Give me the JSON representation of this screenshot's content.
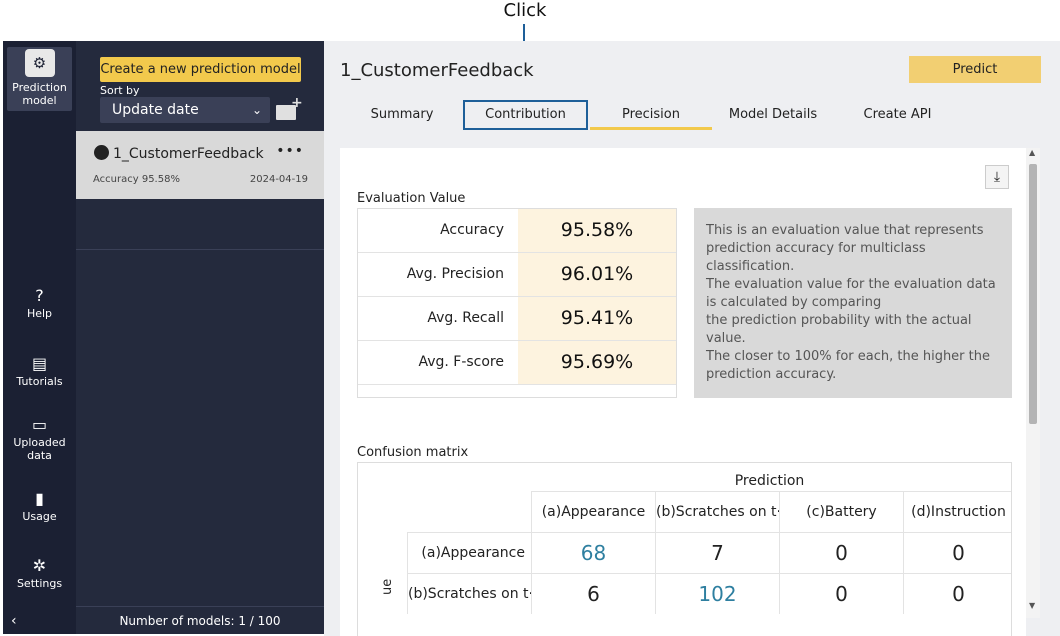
{
  "callout": {
    "label": "Click"
  },
  "rail": {
    "items": [
      {
        "label": "Prediction model"
      },
      {
        "label": "Help"
      },
      {
        "label": "Tutorials"
      },
      {
        "label": "Uploaded data"
      },
      {
        "label": "Usage"
      },
      {
        "label": "Settings"
      }
    ]
  },
  "sidebar": {
    "new_model_button": "Create a new prediction model",
    "sort_label": "Sort by",
    "sort_value": "Update date",
    "models": [
      {
        "name": "1_CustomerFeedback",
        "accuracy": "Accuracy 95.58%",
        "date": "2024-04-19"
      }
    ],
    "footer": "Number of models: 1 / 100"
  },
  "header": {
    "title": "1_CustomerFeedback",
    "predict_button": "Predict"
  },
  "tabs": [
    {
      "label": "Summary"
    },
    {
      "label": "Contribution"
    },
    {
      "label": "Precision"
    },
    {
      "label": "Model Details"
    },
    {
      "label": "Create API"
    }
  ],
  "evaluation": {
    "title": "Evaluation Value",
    "rows": [
      {
        "label": "Accuracy",
        "value": "95.58%"
      },
      {
        "label": "Avg. Precision",
        "value": "96.01%"
      },
      {
        "label": "Avg. Recall",
        "value": "95.41%"
      },
      {
        "label": "Avg. F-score",
        "value": "95.69%"
      }
    ],
    "note": "This is an evaluation value that represents prediction accuracy for multiclass classification.\n The evaluation value for the evaluation data is calculated by comparing\n the prediction probability with the actual value.\n The closer to 100% for each, the higher the prediction accuracy."
  },
  "confusion": {
    "title": "Confusion matrix",
    "prediction_label": "Prediction",
    "true_label_visible": "ue",
    "columns": [
      "(a)Appearance",
      "(b)Scratches on t···",
      "(c)Battery",
      "(d)Instruction"
    ],
    "rows": [
      {
        "label": "(a)Appearance",
        "values": [
          "68",
          "7",
          "0",
          "0"
        ]
      },
      {
        "label": "(b)Scratches on t···",
        "values": [
          "6",
          "102",
          "0",
          "0"
        ]
      }
    ]
  }
}
